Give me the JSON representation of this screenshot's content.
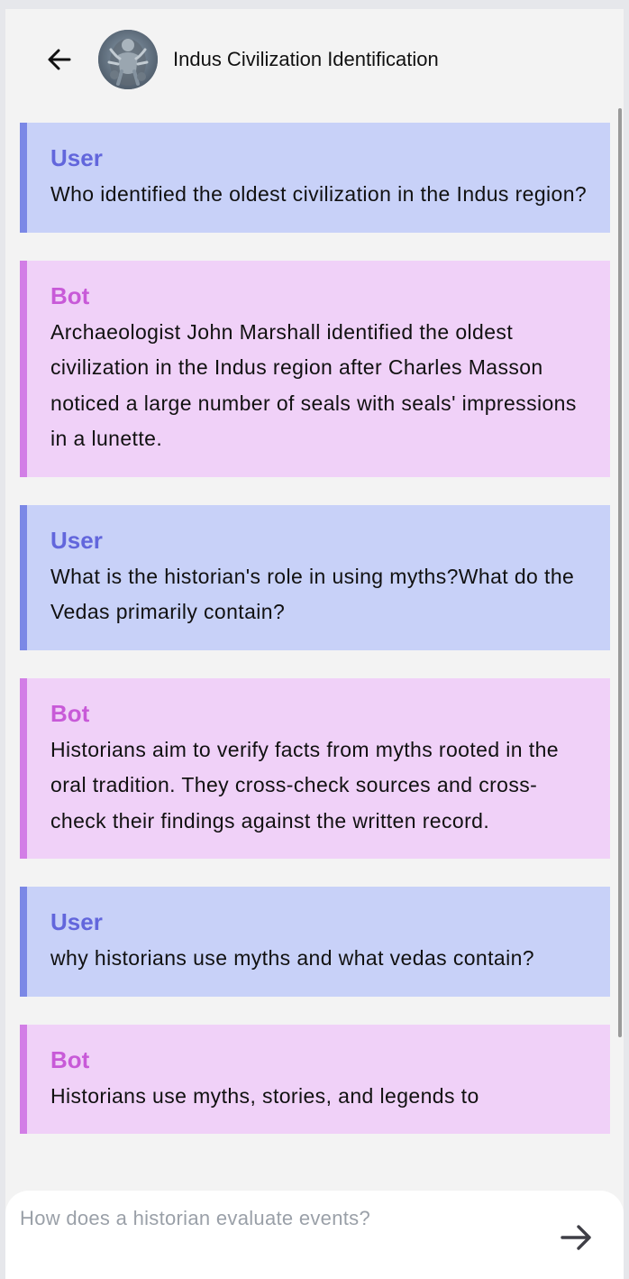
{
  "header": {
    "title": "Indus Civilization Identification"
  },
  "messages": [
    {
      "role": "User",
      "type": "user",
      "text": "Who identified the oldest civilization in the Indus region?"
    },
    {
      "role": "Bot",
      "type": "bot",
      "text": "Archaeologist John Marshall identified the oldest civilization in the Indus region after Charles Masson noticed a large number of seals with seals' impressions in a lunette."
    },
    {
      "role": "User",
      "type": "user",
      "text": "What is the historian's role in using myths?What do the Vedas primarily contain?"
    },
    {
      "role": "Bot",
      "type": "bot",
      "text": "Historians aim to verify facts from myths rooted in the oral tradition. They cross-check sources and cross-check their findings against the written record."
    },
    {
      "role": "User",
      "type": "user",
      "text": "why historians use myths and what vedas contain?"
    },
    {
      "role": "Bot",
      "type": "bot",
      "text": "Historians use myths, stories, and legends to"
    }
  ],
  "composer": {
    "placeholder": "How does a historian evaluate events?",
    "value": ""
  },
  "icons": {
    "back": "arrow-left-icon",
    "send": "arrow-right-icon"
  },
  "colors": {
    "user_bg": "#c8d1f8",
    "user_accent": "#7b88e6",
    "bot_bg": "#f0d1f8",
    "bot_accent": "#d27ee6"
  }
}
